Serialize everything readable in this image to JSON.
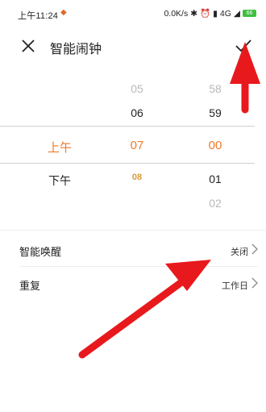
{
  "status_bar": {
    "time": "上午11:24",
    "net_speed": "0.0K/s",
    "network": "4G",
    "battery": "66",
    "app_icon": "notification-diamond-icon"
  },
  "header": {
    "title": "智能闹钟",
    "close_icon": "close-icon",
    "confirm_icon": "check-icon"
  },
  "picker": {
    "ampm": [
      "上午",
      "下午"
    ],
    "hours": [
      "05",
      "06",
      "07",
      "08"
    ],
    "minutes": [
      "58",
      "59",
      "00",
      "01",
      "02"
    ],
    "selected": {
      "ampm": "上午",
      "hour": "07",
      "minute": "00"
    },
    "accent_color": "#f07a2a"
  },
  "settings": [
    {
      "label": "智能唤醒",
      "value": "关闭"
    },
    {
      "label": "重复",
      "value": "工作日"
    }
  ],
  "annotation": {
    "arrow_color": "#e8191c"
  }
}
